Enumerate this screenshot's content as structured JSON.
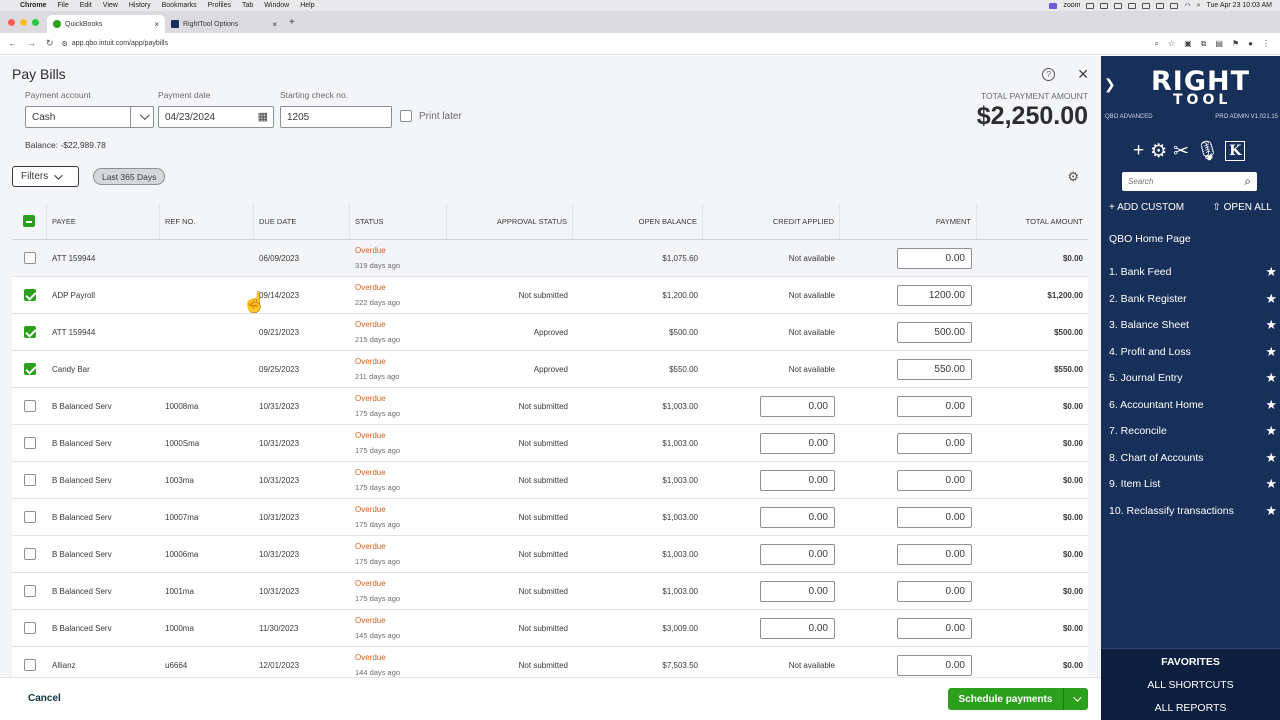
{
  "mac_menu": {
    "app": "Chrome",
    "items": [
      "File",
      "Edit",
      "View",
      "History",
      "Bookmarks",
      "Profiles",
      "Tab",
      "Window",
      "Help"
    ],
    "zoom_label": "zoom",
    "datetime": "Tue Apr 23  10:03 AM"
  },
  "browser": {
    "tabs": [
      {
        "label": "QuickBooks",
        "active": true
      },
      {
        "label": "RightTool Options",
        "active": false
      }
    ],
    "url": "app.qbo.intuit.com/app/paybills"
  },
  "header": {
    "title": "Pay Bills",
    "help": "?",
    "close": "✕"
  },
  "form": {
    "payment_account_label": "Payment account",
    "payment_account_value": "Cash",
    "payment_date_label": "Payment date",
    "payment_date_value": "04/23/2024",
    "check_no_label": "Starting check no.",
    "check_no_value": "1205",
    "print_later_label": "Print later",
    "balance_text": "Balance: -$22,989.78",
    "total_label": "TOTAL PAYMENT AMOUNT",
    "total_value": "$2,250.00"
  },
  "filters": {
    "button_label": "Filters",
    "pill_label": "Last 365 Days"
  },
  "table": {
    "headers": [
      "",
      "PAYEE",
      "REF NO.",
      "DUE DATE",
      "STATUS",
      "APPROVAL STATUS",
      "OPEN BALANCE",
      "CREDIT APPLIED",
      "PAYMENT",
      "TOTAL AMOUNT"
    ],
    "rows": [
      {
        "checked": false,
        "payee": "ATT 159944",
        "ref": "",
        "due": "06/09/2023",
        "status": "Overdue",
        "ago": "319 days ago",
        "approval": "",
        "open": "$1,075.60",
        "credit": "Not available",
        "credit_input": false,
        "payment": "0.00",
        "total": "$0.00"
      },
      {
        "checked": true,
        "payee": "ADP Payroll",
        "ref": "",
        "due": "09/14/2023",
        "status": "Overdue",
        "ago": "222 days ago",
        "approval": "Not submitted",
        "open": "$1,200.00",
        "credit": "Not available",
        "credit_input": false,
        "payment": "1200.00",
        "total": "$1,200.00"
      },
      {
        "checked": true,
        "payee": "ATT 159944",
        "ref": "",
        "due": "09/21/2023",
        "status": "Overdue",
        "ago": "215 days ago",
        "approval": "Approved",
        "open": "$500.00",
        "credit": "Not available",
        "credit_input": false,
        "payment": "500.00",
        "total": "$500.00"
      },
      {
        "checked": true,
        "payee": "Candy Bar",
        "ref": "",
        "due": "09/25/2023",
        "status": "Overdue",
        "ago": "211 days ago",
        "approval": "Approved",
        "open": "$550.00",
        "credit": "Not available",
        "credit_input": false,
        "payment": "550.00",
        "total": "$550.00"
      },
      {
        "checked": false,
        "payee": "B Balanced Serv",
        "ref": "10008ma",
        "due": "10/31/2023",
        "status": "Overdue",
        "ago": "175 days ago",
        "approval": "Not submitted",
        "open": "$1,003.00",
        "credit": "0.00",
        "credit_input": true,
        "payment": "0.00",
        "total": "$0.00"
      },
      {
        "checked": false,
        "payee": "B Balanced Serv",
        "ref": "1000Sma",
        "due": "10/31/2023",
        "status": "Overdue",
        "ago": "175 days ago",
        "approval": "Not submitted",
        "open": "$1,003.00",
        "credit": "0.00",
        "credit_input": true,
        "payment": "0.00",
        "total": "$0.00"
      },
      {
        "checked": false,
        "payee": "B Balanced Serv",
        "ref": "1003ma",
        "due": "10/31/2023",
        "status": "Overdue",
        "ago": "175 days ago",
        "approval": "Not submitted",
        "open": "$1,003.00",
        "credit": "0.00",
        "credit_input": true,
        "payment": "0.00",
        "total": "$0.00"
      },
      {
        "checked": false,
        "payee": "B Balanced Serv",
        "ref": "10007ma",
        "due": "10/31/2023",
        "status": "Overdue",
        "ago": "175 days ago",
        "approval": "Not submitted",
        "open": "$1,003.00",
        "credit": "0.00",
        "credit_input": true,
        "payment": "0.00",
        "total": "$0.00"
      },
      {
        "checked": false,
        "payee": "B Balanced Serv",
        "ref": "10006ma",
        "due": "10/31/2023",
        "status": "Overdue",
        "ago": "175 days ago",
        "approval": "Not submitted",
        "open": "$1,003.00",
        "credit": "0.00",
        "credit_input": true,
        "payment": "0.00",
        "total": "$0.00"
      },
      {
        "checked": false,
        "payee": "B Balanced Serv",
        "ref": "1001ma",
        "due": "10/31/2023",
        "status": "Overdue",
        "ago": "175 days ago",
        "approval": "Not submitted",
        "open": "$1,003.00",
        "credit": "0.00",
        "credit_input": true,
        "payment": "0.00",
        "total": "$0.00"
      },
      {
        "checked": false,
        "payee": "B Balanced Serv",
        "ref": "1000ma",
        "due": "11/30/2023",
        "status": "Overdue",
        "ago": "145 days ago",
        "approval": "Not submitted",
        "open": "$3,009.00",
        "credit": "0.00",
        "credit_input": true,
        "payment": "0.00",
        "total": "$0.00"
      },
      {
        "checked": false,
        "payee": "Allianz",
        "ref": "u6664",
        "due": "12/01/2023",
        "status": "Overdue",
        "ago": "144 days ago",
        "approval": "Not submitted",
        "open": "$7,503.50",
        "credit": "Not available",
        "credit_input": false,
        "payment": "0.00",
        "total": "$0.00"
      }
    ]
  },
  "footer": {
    "cancel_label": "Cancel",
    "schedule_label": "Schedule payments"
  },
  "righttool": {
    "logo_top": "RIGHT",
    "logo_bottom": "TOOL",
    "edition": "QBO ADVANCED",
    "version": "PRO ADMIN V1.021.15",
    "search_placeholder": "Search",
    "add_custom": "+ ADD CUSTOM",
    "open_all": "⇧ OPEN ALL",
    "home": "QBO Home Page",
    "shortcuts": [
      "1. Bank Feed",
      "2. Bank Register",
      "3. Balance Sheet",
      "4. Profit and Loss",
      "5. Journal Entry",
      "6. Accountant Home",
      "7. Reconcile",
      "8. Chart of Accounts",
      "9. Item List",
      "10. Reclassify transactions"
    ],
    "favorites_label": "FAVORITES",
    "all_shortcuts": "ALL SHORTCUTS",
    "all_reports": "ALL REPORTS",
    "bg_color": "#17305a"
  },
  "colors": {
    "accent": "#2ca01c",
    "overdue": "#d4611c"
  }
}
